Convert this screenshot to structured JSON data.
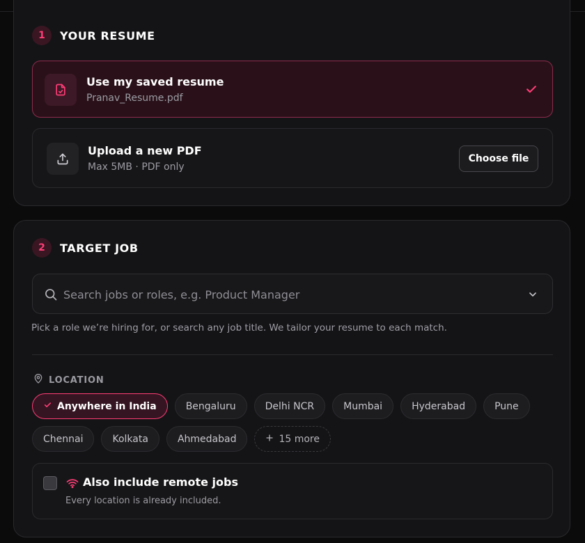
{
  "resume": {
    "step_number": "1",
    "title": "YOUR RESUME",
    "saved": {
      "title": "Use my saved resume",
      "filename": "Pranav_Resume.pdf",
      "selected": true
    },
    "upload": {
      "title": "Upload a new PDF",
      "hint": "Max 5MB · PDF only",
      "button": "Choose file"
    }
  },
  "target": {
    "step_number": "2",
    "title": "TARGET JOB",
    "search_placeholder": "Search jobs or roles, e.g. Product Manager",
    "hint": "Pick a role we’re hiring for, or search any job title. We tailor your resume to each match.",
    "location_label": "LOCATION",
    "locations_row1": [
      {
        "label": "Anywhere in India",
        "active": true
      },
      {
        "label": "Bengaluru",
        "active": false
      },
      {
        "label": "Delhi NCR",
        "active": false
      },
      {
        "label": "Mumbai",
        "active": false
      },
      {
        "label": "Hyderabad",
        "active": false
      },
      {
        "label": "Pune",
        "active": false
      }
    ],
    "locations_row2": [
      {
        "label": "Chennai",
        "active": false
      },
      {
        "label": "Kolkata",
        "active": false
      },
      {
        "label": "Ahmedabad",
        "active": false
      }
    ],
    "more_label": "15 more",
    "remote": {
      "title": "Also include remote jobs",
      "subtitle": "Every location is already included.",
      "checked": false
    }
  },
  "colors": {
    "accent": "#ff3d77",
    "card_bg": "#141416",
    "page_bg": "#0b0b0c"
  },
  "icons": {
    "saved": "file-check-icon",
    "upload": "upload-icon",
    "check": "check-icon",
    "search": "search-icon",
    "chevron": "chevron-down-icon",
    "location": "map-pin-icon",
    "remote": "wifi-icon"
  }
}
